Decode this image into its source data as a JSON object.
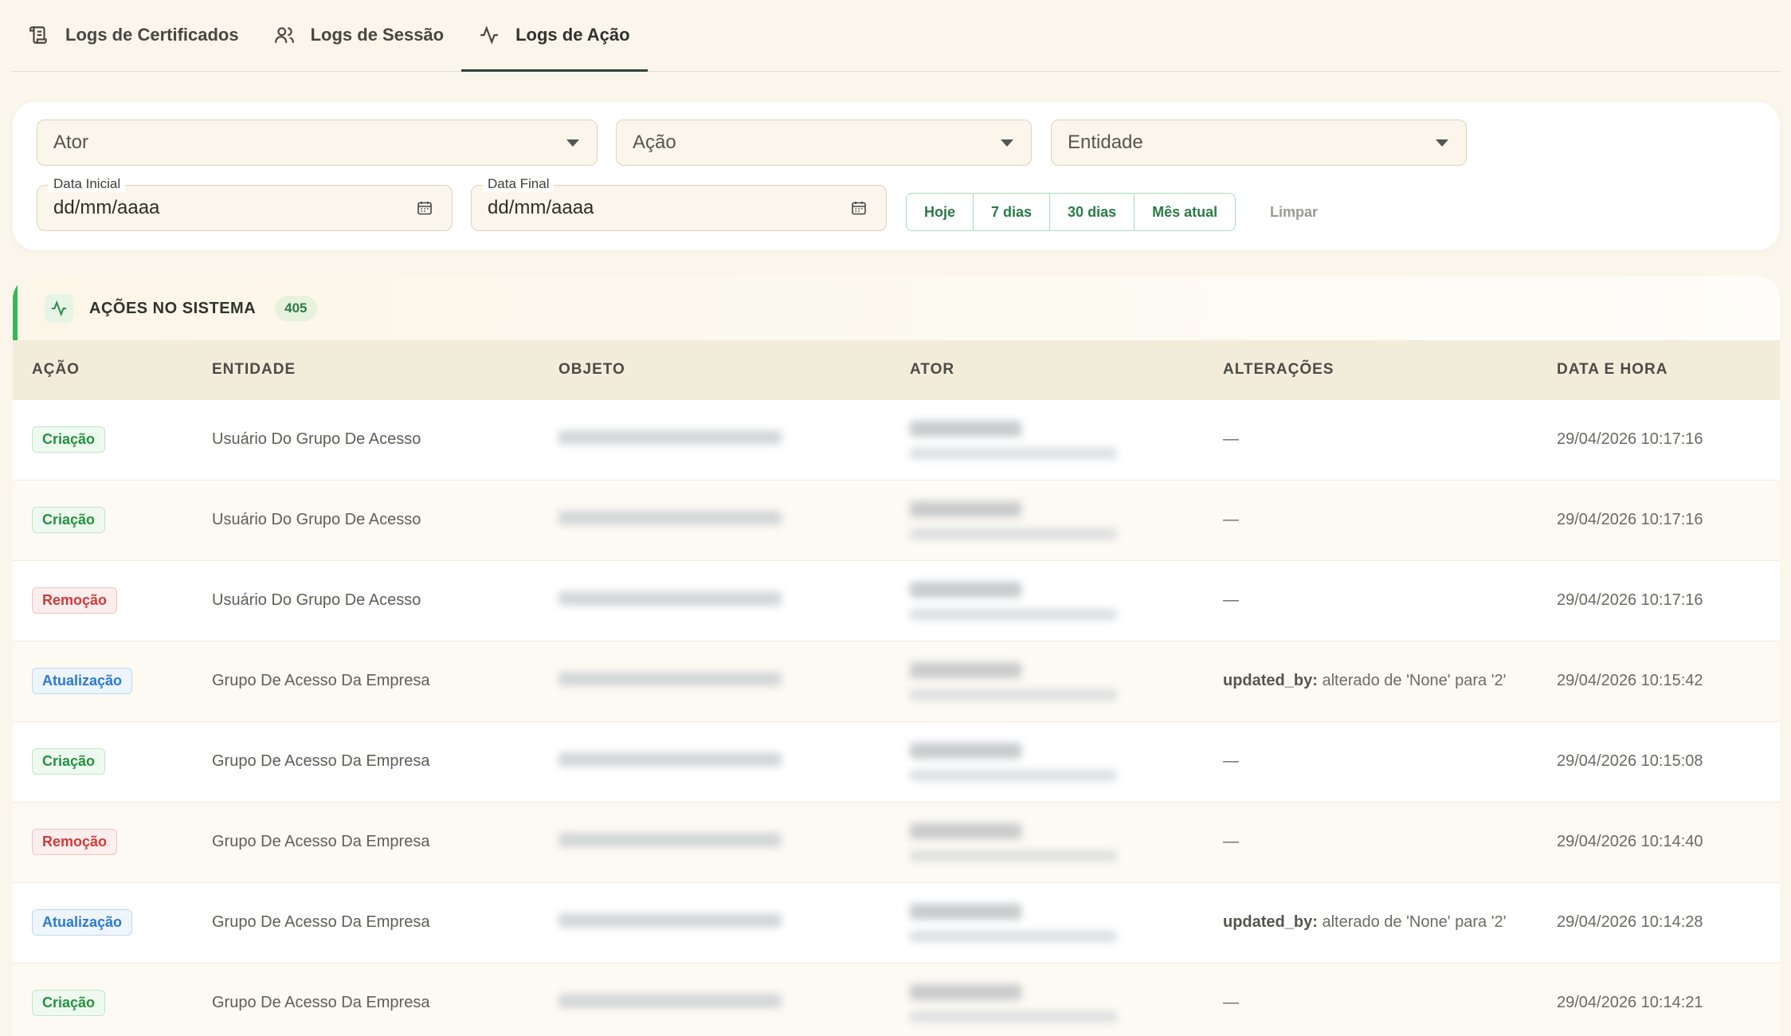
{
  "tabs": [
    {
      "label": "Logs de Certificados",
      "icon": "scroll-icon"
    },
    {
      "label": "Logs de Sessão",
      "icon": "users-icon"
    },
    {
      "label": "Logs de Ação",
      "icon": "activity-icon",
      "active": true
    }
  ],
  "filters": {
    "actor_placeholder": "Ator",
    "action_placeholder": "Ação",
    "entity_placeholder": "Entidade",
    "start_label": "Data Inicial",
    "start_value": "dd/mm/aaaa",
    "end_label": "Data Final",
    "end_value": "dd/mm/aaaa",
    "quick": [
      "Hoje",
      "7 dias",
      "30 dias",
      "Mês atual"
    ],
    "clear": "Limpar"
  },
  "section": {
    "title": "AÇÕES NO SISTEMA",
    "count": "405"
  },
  "columns": [
    "AÇÃO",
    "ENTIDADE",
    "OBJETO",
    "ATOR",
    "ALTERAÇÕES",
    "DATA E HORA"
  ],
  "rows": [
    {
      "action": "Criação",
      "type": "criacao",
      "entity": "Usuário Do Grupo De Acesso",
      "change_key": "",
      "change_text": "—",
      "datetime": "29/04/2026 10:17:16"
    },
    {
      "action": "Criação",
      "type": "criacao",
      "entity": "Usuário Do Grupo De Acesso",
      "change_key": "",
      "change_text": "—",
      "datetime": "29/04/2026 10:17:16"
    },
    {
      "action": "Remoção",
      "type": "remocao",
      "entity": "Usuário Do Grupo De Acesso",
      "change_key": "",
      "change_text": "—",
      "datetime": "29/04/2026 10:17:16"
    },
    {
      "action": "Atualização",
      "type": "atualizacao",
      "entity": "Grupo De Acesso Da Empresa",
      "change_key": "updated_by:",
      "change_text": " alterado de 'None' para '2'",
      "datetime": "29/04/2026 10:15:42"
    },
    {
      "action": "Criação",
      "type": "criacao",
      "entity": "Grupo De Acesso Da Empresa",
      "change_key": "",
      "change_text": "—",
      "datetime": "29/04/2026 10:15:08"
    },
    {
      "action": "Remoção",
      "type": "remocao",
      "entity": "Grupo De Acesso Da Empresa",
      "change_key": "",
      "change_text": "—",
      "datetime": "29/04/2026 10:14:40"
    },
    {
      "action": "Atualização",
      "type": "atualizacao",
      "entity": "Grupo De Acesso Da Empresa",
      "change_key": "updated_by:",
      "change_text": " alterado de 'None' para '2'",
      "datetime": "29/04/2026 10:14:28"
    },
    {
      "action": "Criação",
      "type": "criacao",
      "entity": "Grupo De Acesso Da Empresa",
      "change_key": "",
      "change_text": "—",
      "datetime": "29/04/2026 10:14:21"
    }
  ]
}
